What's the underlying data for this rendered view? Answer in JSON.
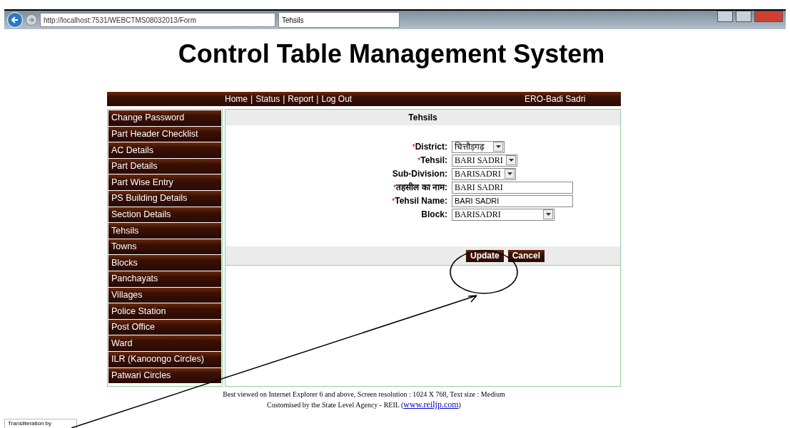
{
  "browser": {
    "address": "http://localhost:7531/WEBCTMS08032013/Form",
    "tab": "Tehsils"
  },
  "title": "Control Table Management System",
  "nav": {
    "links": [
      "Home",
      "Status",
      "Report",
      "Log Out"
    ],
    "separators": [
      "|",
      "|",
      "|"
    ],
    "user": "ERO-Badi Sadri"
  },
  "sidebar": {
    "items": [
      "Change Password",
      "Part Header Checklist",
      "AC Details",
      "Part Details",
      "Part Wise Entry",
      "PS Building Details",
      "Section Details",
      "Tehsils",
      "Towns",
      "Blocks",
      "Panchayats",
      "Villages",
      "Police Station",
      "Post Office",
      "Ward",
      "ILR (Kanoongo Circles)",
      "Patwari Circles"
    ]
  },
  "form": {
    "title": "Tehsils",
    "fields": [
      {
        "mark": "*",
        "label": "District:",
        "kind": "select",
        "value": "चित्तौड़गढ़"
      },
      {
        "mark": "*",
        "label": "Tehsil:",
        "kind": "select",
        "value": "BARI SADRI"
      },
      {
        "label": "Sub-Division:",
        "kind": "select",
        "value": "BARISADRI"
      },
      {
        "mark": "*",
        "label": "तहसील का नाम:",
        "kind": "text",
        "value": "BARI SADRI"
      },
      {
        "mark": "*",
        "label": "Tehsil Name:",
        "kind": "text",
        "value": "BARI SADRI"
      },
      {
        "label": "Block:",
        "kind": "select",
        "value": "BARISADRI"
      }
    ],
    "buttons": [
      "Update",
      "Cancel"
    ]
  },
  "footer": {
    "line1": "Best viewed on Internet Explorer 6 and above, Screen resolution : 1024 X 768, Text size : Medium",
    "line2": "Customised by the State Level Agency - REIL (",
    "link": "www.reiljp.com",
    "line2_end": ")"
  },
  "transliteration": "Transliteration by"
}
